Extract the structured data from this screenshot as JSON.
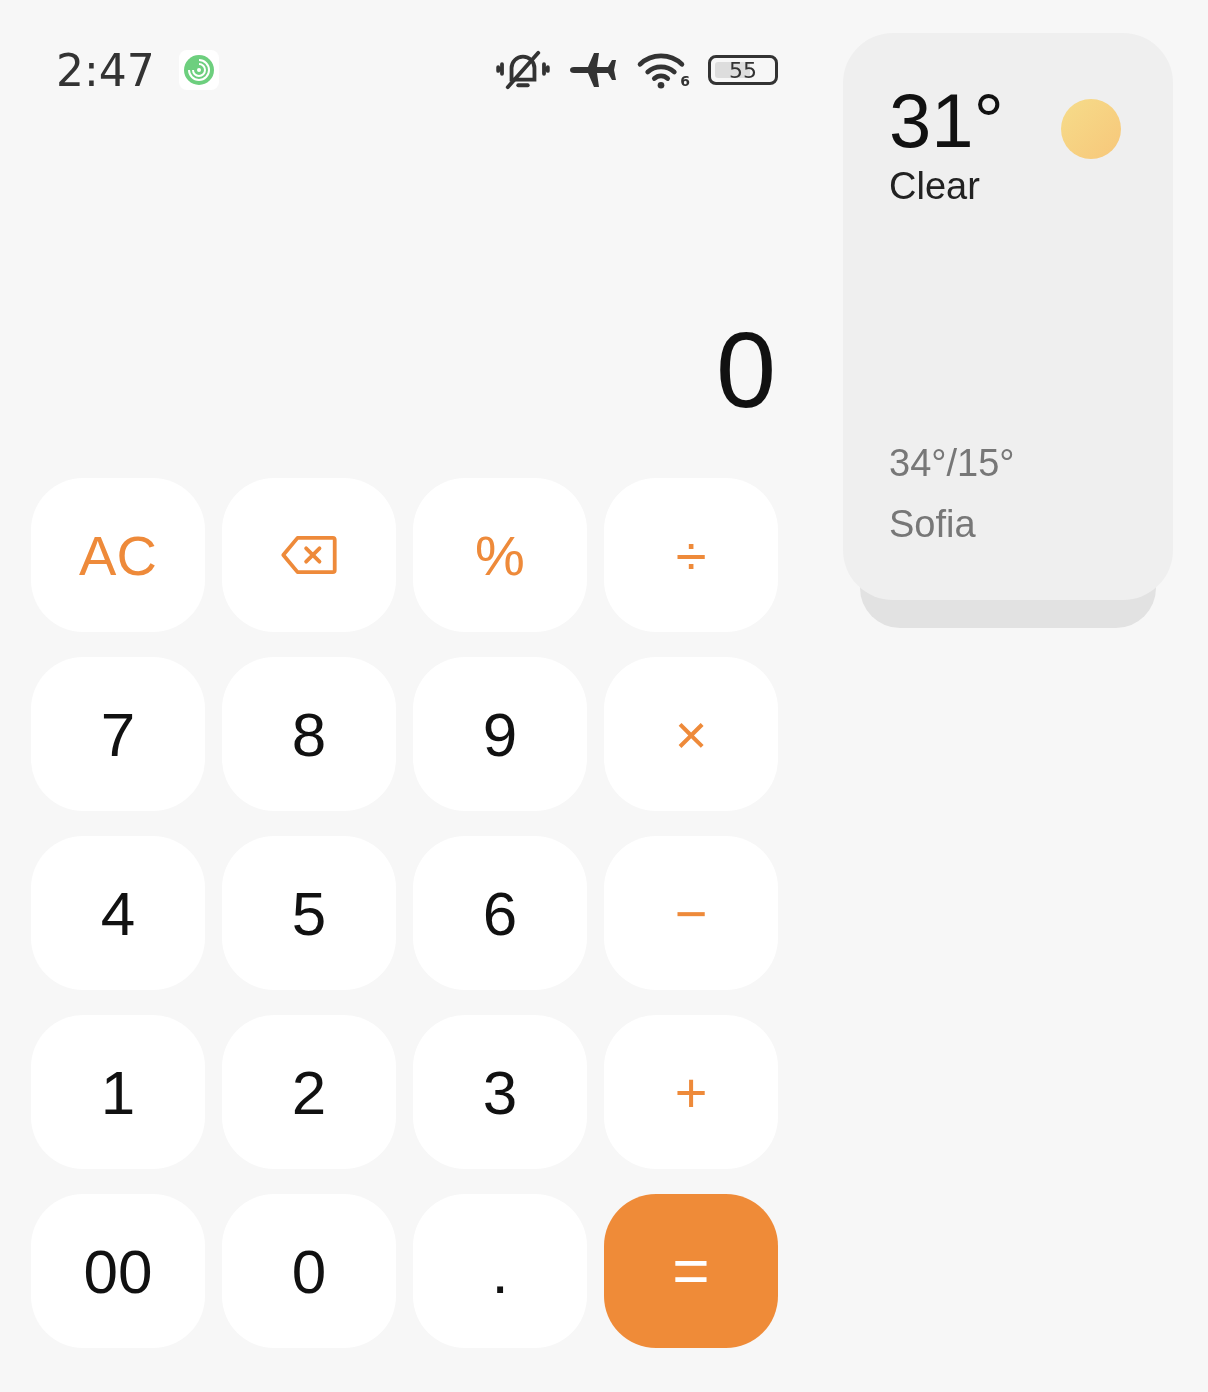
{
  "status_bar": {
    "time": "2:47",
    "wifi_generation": "6",
    "battery": "55"
  },
  "display": {
    "value": "0"
  },
  "keys": [
    {
      "kind": "op",
      "label": "AC"
    },
    {
      "kind": "backspace"
    },
    {
      "kind": "op",
      "label": "%"
    },
    {
      "kind": "op",
      "label": "÷"
    },
    {
      "kind": "digit",
      "label": "7"
    },
    {
      "kind": "digit",
      "label": "8"
    },
    {
      "kind": "digit",
      "label": "9"
    },
    {
      "kind": "op",
      "label": "×"
    },
    {
      "kind": "digit",
      "label": "4"
    },
    {
      "kind": "digit",
      "label": "5"
    },
    {
      "kind": "digit",
      "label": "6"
    },
    {
      "kind": "op",
      "label": "−"
    },
    {
      "kind": "digit",
      "label": "1"
    },
    {
      "kind": "digit",
      "label": "2"
    },
    {
      "kind": "digit",
      "label": "3"
    },
    {
      "kind": "op",
      "label": "+"
    },
    {
      "kind": "digit",
      "label": "00"
    },
    {
      "kind": "digit",
      "label": "0"
    },
    {
      "kind": "digit",
      "label": "."
    },
    {
      "kind": "equals",
      "label": "="
    }
  ],
  "weather": {
    "temperature": "31°",
    "condition": "Clear",
    "range": "34°/15°",
    "city": "Sofia"
  }
}
